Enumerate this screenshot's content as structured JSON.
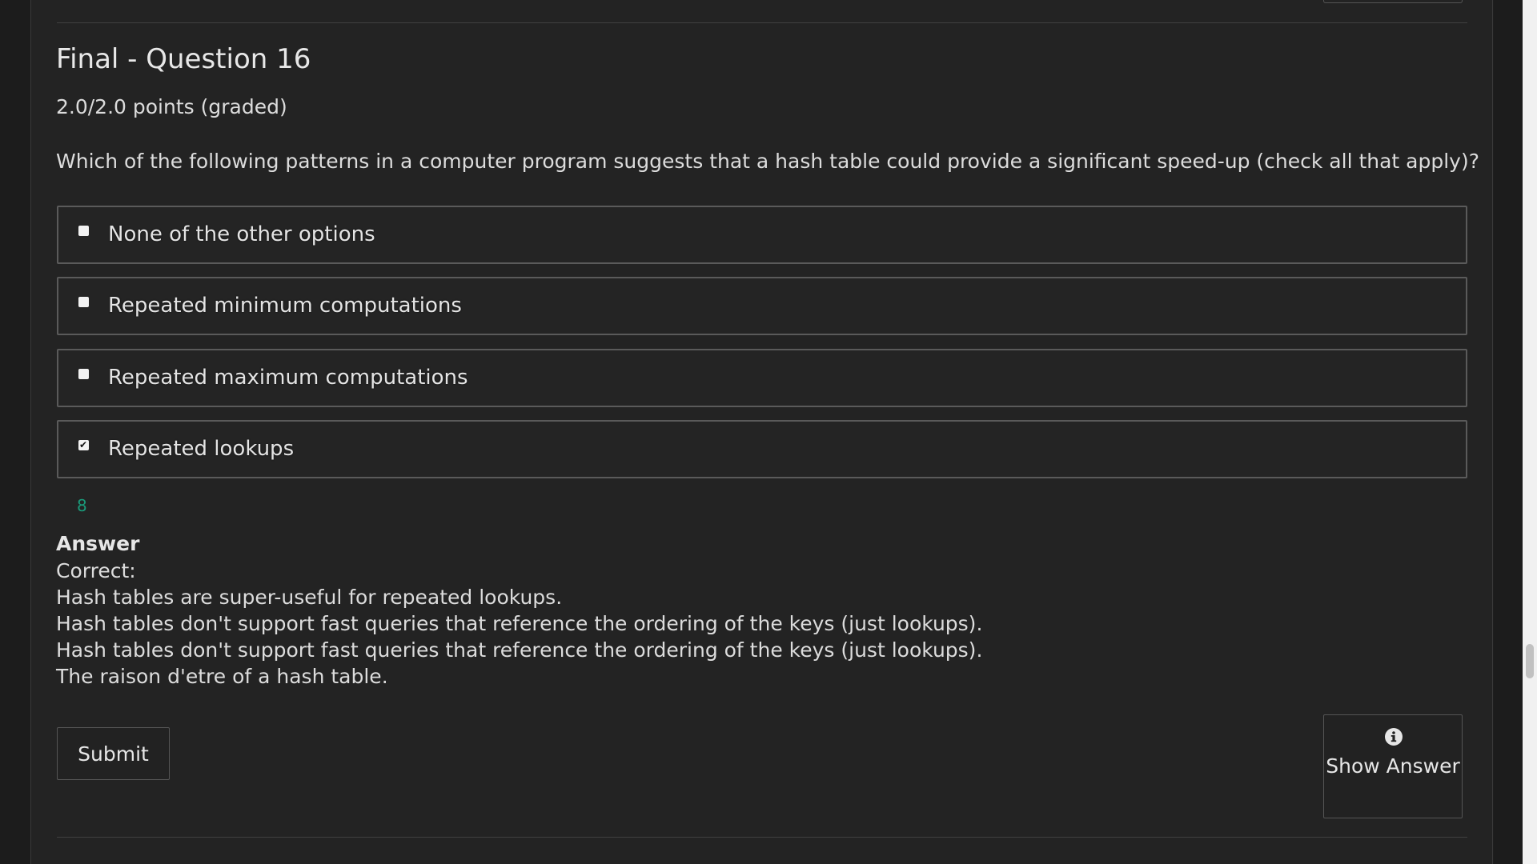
{
  "question": {
    "title": "Final - Question 16",
    "points": "2.0/2.0 points (graded)",
    "prompt": "Which of the following patterns in a computer program suggests that a hash table could provide a significant speed-up (check all that apply)?"
  },
  "options": [
    {
      "label": "None of the other options",
      "checked": false
    },
    {
      "label": "Repeated minimum computations",
      "checked": false
    },
    {
      "label": "Repeated maximum computations",
      "checked": false
    },
    {
      "label": "Repeated lookups",
      "checked": true
    }
  ],
  "status_indicator": "8",
  "answer": {
    "heading": "Answer",
    "lines": [
      "Correct:",
      "Hash tables are super-useful for repeated lookups.",
      "Hash tables don't support fast queries that reference the ordering of the keys (just lookups).",
      "Hash tables don't support fast queries that reference the ordering of the keys (just lookups).",
      "The raison d'etre of a hash table."
    ]
  },
  "buttons": {
    "submit_label": "Submit",
    "show_answer_label": "Show Answer",
    "show_answer_icon": "info-circle-icon"
  },
  "colors": {
    "background": "#232323",
    "status_indicator": "#1a9a7a",
    "text": "#dcdcdc"
  }
}
